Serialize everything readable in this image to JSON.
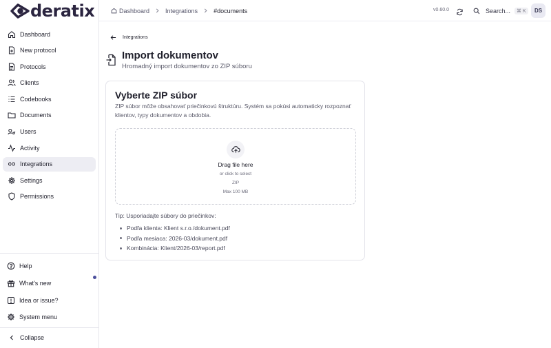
{
  "brand": {
    "name": "deratix"
  },
  "sidebar": {
    "items": [
      {
        "label": "Dashboard",
        "icon": "home-icon"
      },
      {
        "label": "New protocol",
        "icon": "file-plus-icon"
      },
      {
        "label": "Protocols",
        "icon": "file-text-icon"
      },
      {
        "label": "Clients",
        "icon": "users-icon"
      },
      {
        "label": "Codebooks",
        "icon": "list-icon"
      },
      {
        "label": "Documents",
        "icon": "folder-icon"
      },
      {
        "label": "Users",
        "icon": "user-key-icon"
      },
      {
        "label": "Activity",
        "icon": "activity-icon"
      },
      {
        "label": "Integrations",
        "icon": "link-icon",
        "active": true
      },
      {
        "label": "Settings",
        "icon": "gear-icon"
      },
      {
        "label": "Permissions",
        "icon": "shield-icon"
      }
    ],
    "bottom": [
      {
        "label": "Help",
        "icon": "help-icon"
      },
      {
        "label": "What's new",
        "icon": "gift-icon"
      },
      {
        "label": "Idea or issue?",
        "icon": "message-icon"
      },
      {
        "label": "System menu",
        "icon": "gear-icon"
      }
    ],
    "collapse_label": "Collapse"
  },
  "topbar": {
    "breadcrumbs": [
      "Dashboard",
      "Integrations",
      "#documents"
    ],
    "version": "v0.60.0",
    "search_label": "Search...",
    "search_shortcut": "⌘ K",
    "avatar_initials": "DS"
  },
  "main": {
    "back_label": "Integrations",
    "title": "Import dokumentov",
    "subtitle": "Hromadný import dokumentov zo ZIP súboru",
    "card": {
      "title": "Vyberte ZIP súbor",
      "description": "ZIP súbor môže obsahovať priečinkovú štruktúru. Systém sa pokúsi automaticky rozpoznať klientov, typy dokumentov a obdobia.",
      "dropzone": {
        "main": "Drag file here",
        "sub": "or click to select",
        "type": "ZIP",
        "max": "Max 100 MB"
      },
      "tip_title": "Tip: Usporiadajte súbory do priečinkov:",
      "tips": [
        "Podľa klienta: Klient s.r.o./dokument.pdf",
        "Podľa mesiaca: 2026-03/dokument.pdf",
        "Kombinácia: Klient/2026-03/report.pdf"
      ]
    }
  },
  "colors": {
    "accent": "#4b4f9c",
    "active_bg": "#ededf3",
    "text": "#1f1f2b"
  }
}
